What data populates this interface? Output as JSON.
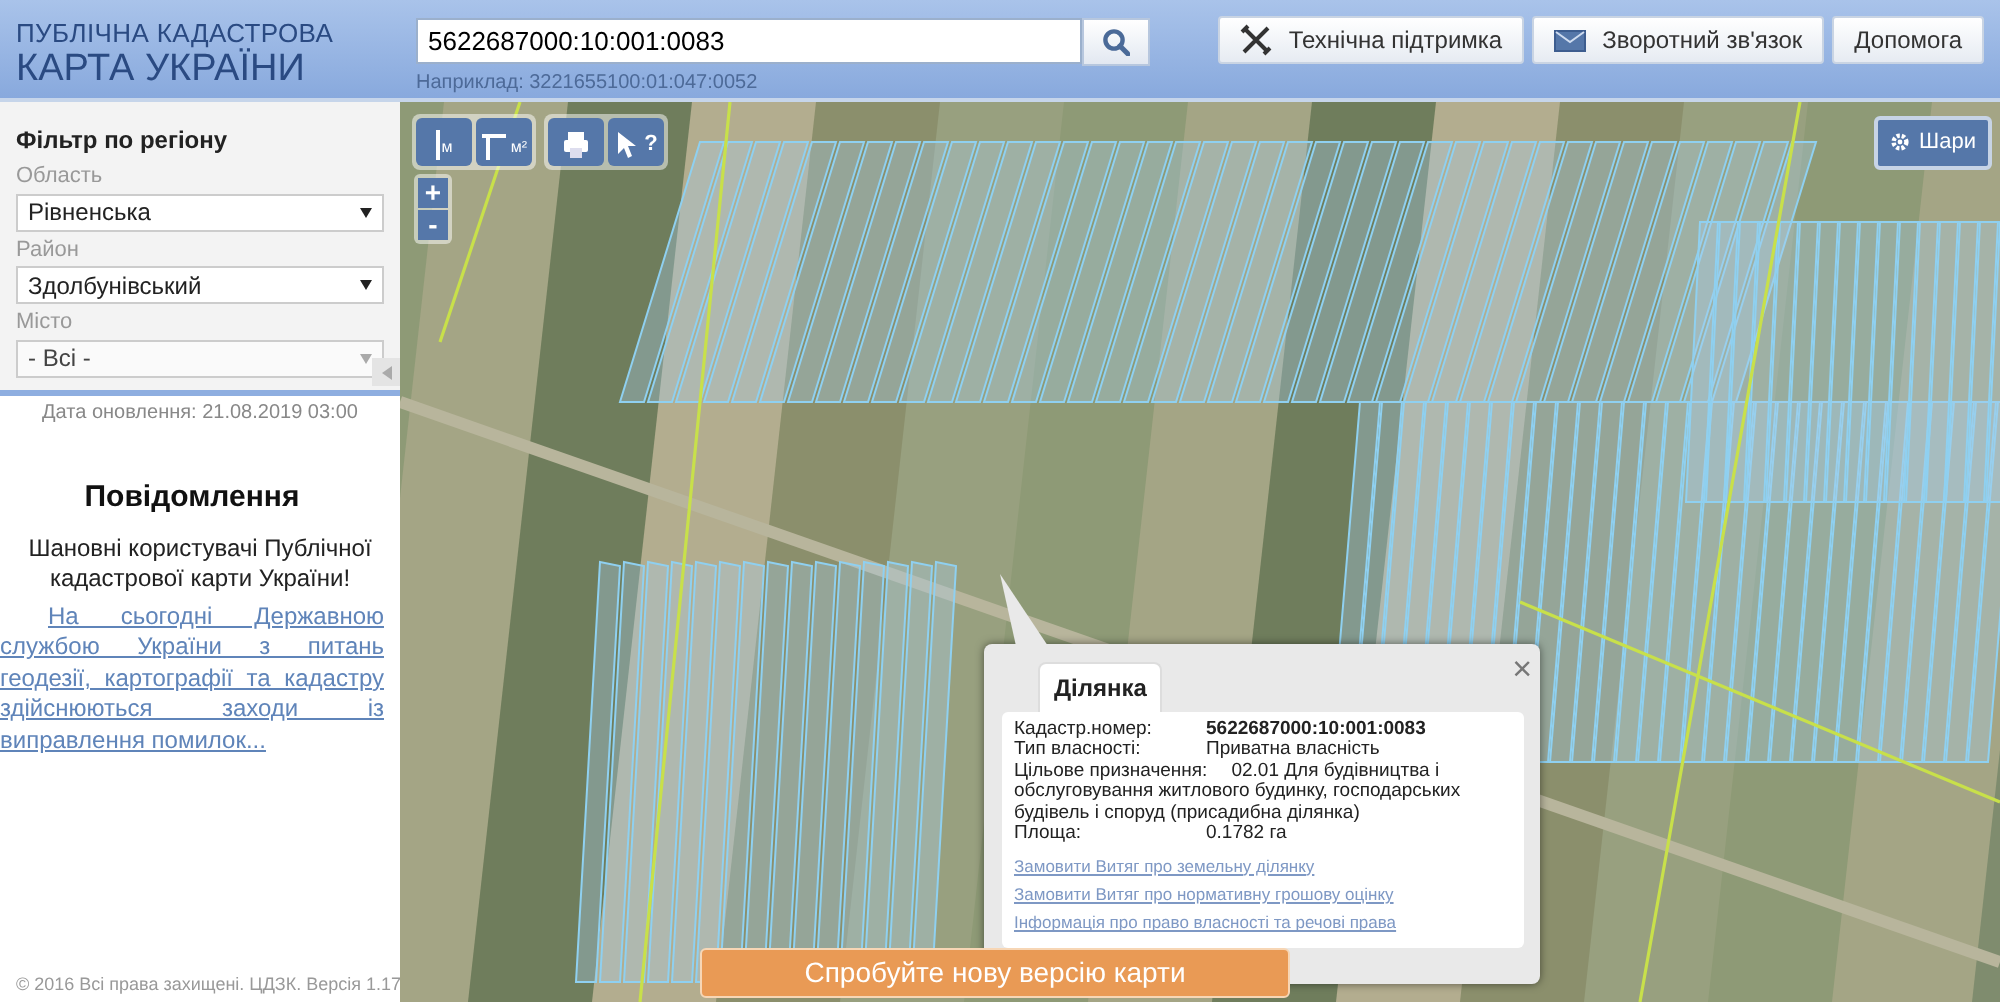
{
  "header": {
    "title_line_1": "ПУБЛІЧНА КАДАСТРОВА",
    "title_line_2": "КАРТА УКРАЇНИ",
    "search": {
      "value": "5622687000:10:001:0083",
      "example": "Наприклад: 3221655100:01:047:0052"
    },
    "buttons": [
      {
        "kind": "support",
        "label": "Технічна підтримка"
      },
      {
        "kind": "feedback",
        "label": "Зворотний зв'язок"
      },
      {
        "kind": "help",
        "label": "Допомога"
      }
    ]
  },
  "sidebar": {
    "filter_title": "Фільтр по регіону",
    "filters": [
      {
        "label": "Область",
        "value": "Рівненська",
        "disabled": false
      },
      {
        "label": "Район",
        "value": "Здолбунівський",
        "disabled": false
      },
      {
        "label": "Місто",
        "value": "- Всі -",
        "disabled": true
      }
    ],
    "update_date": "Дата оновлення: 21.08.2019 03:00",
    "notice": {
      "title": "Повідомлення",
      "greeting": "Шановні користувачі Публічної кадастрової карти України!",
      "link": "На сьогодні Державною службою України з питань геодезії, картографії та кадастру здійснюються заходи із виправлення помилок..."
    },
    "footer": "© 2016 Всі права захищені. ЦДЗК. Версія 1.17"
  },
  "map": {
    "tools": [
      {
        "kind": "length",
        "unit": "м"
      },
      {
        "kind": "area",
        "unit": "м²"
      },
      {
        "kind": "print"
      },
      {
        "kind": "identify",
        "mark": "?"
      }
    ],
    "zoom": [
      "+",
      "-"
    ],
    "layers_button": "Шари",
    "popup": {
      "close": "×",
      "tab": "Ділянка",
      "fields": [
        {
          "label": "Кадастр.номер:",
          "value": "5622687000:10:001:0083",
          "bold": true
        },
        {
          "label": "Тип власності:",
          "value": "Приватна власність",
          "bold": false
        },
        {
          "label": "Цільове призначення:",
          "value": "02.01 Для будівництва і обслуговування житлового будинку, господарських будівель і споруд (присадибна ділянка)",
          "bold": false
        },
        {
          "label": "Площа:",
          "value": "0.1782 га",
          "bold": false
        }
      ],
      "links": [
        "Замовити Витяг про земельну ділянку",
        "Замовити Витяг про нормативну грошову оцінку",
        "Інформація про право власності та речові права"
      ]
    },
    "banner": "Спробуйте нову версію карти"
  }
}
